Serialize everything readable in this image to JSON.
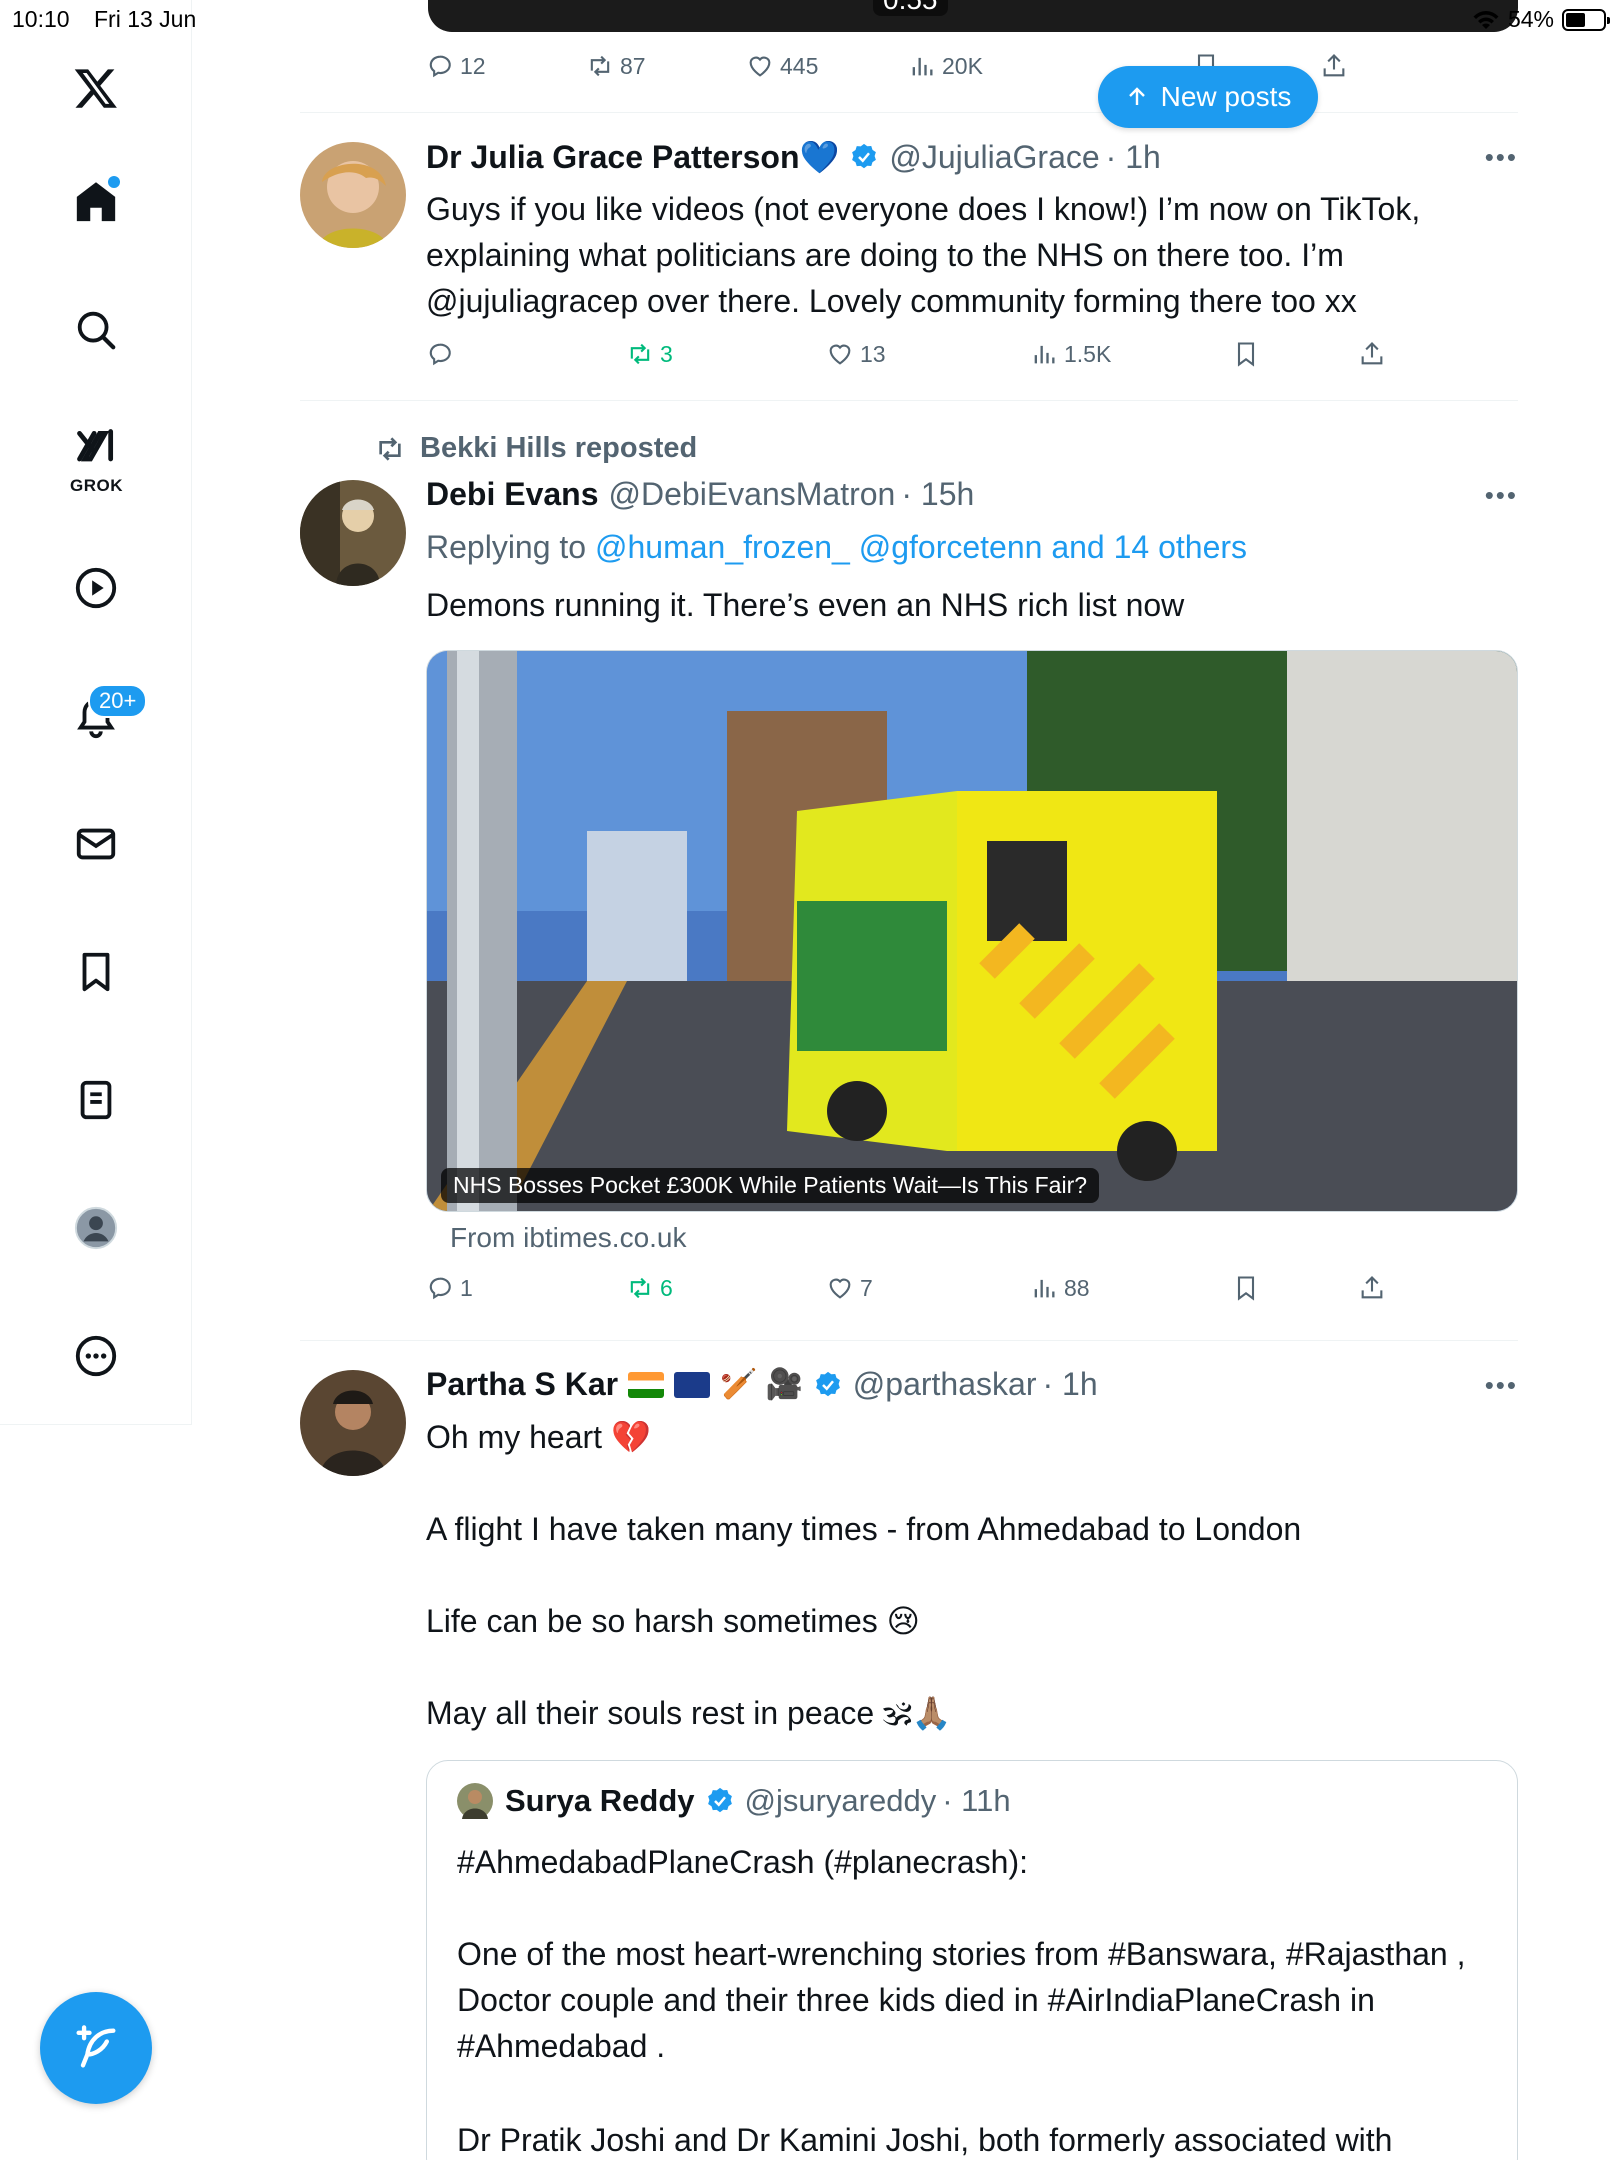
{
  "status_bar": {
    "time": "10:10",
    "date": "Fri 13 Jun",
    "battery": "54%",
    "battery_level": 0.54
  },
  "sidebar": {
    "grok_label": "GROK",
    "notifications_badge": "20+",
    "items": [
      "x-logo",
      "home",
      "search",
      "grok",
      "video",
      "notifications",
      "messages",
      "bookmarks",
      "lists",
      "profile",
      "more"
    ]
  },
  "new_posts_label": "New posts",
  "top_post": {
    "video_time": "0:55",
    "replies": "12",
    "reposts": "87",
    "likes": "445",
    "views": "20K"
  },
  "post1": {
    "name": "Dr Julia Grace Patterson💙",
    "handle": "@JujuliaGrace",
    "time": "· 1h",
    "text": "Guys if you like videos (not everyone does I know!) I’m now on TikTok, explaining what politicians are doing to the NHS on there too. I’m @jujuliagracep over there. Lovely community forming there too xx",
    "replies": "",
    "reposts": "3",
    "likes": "13",
    "views": "1.5K"
  },
  "post2": {
    "reposted_by": "Bekki Hills reposted",
    "name": "Debi Evans",
    "handle": "@DebiEvansMatron",
    "time": "· 15h",
    "replying_prefix": "Replying to ",
    "replying_targets": "@human_frozen_ @gforcetenn and 14 others",
    "text": "Demons running it. There’s even an NHS rich list now",
    "media_caption": "NHS Bosses Pocket £300K While Patients Wait—Is This Fair?",
    "source": "From ibtimes.co.uk",
    "replies": "1",
    "reposts": "6",
    "likes": "7",
    "views": "88"
  },
  "post3": {
    "name": "Partha S Kar",
    "handle": "@parthaskar",
    "time": "· 1h",
    "line1": "Oh my heart 💔",
    "line2": "A flight I have taken many times - from Ahmedabad to London",
    "line3": "Life can be so harsh sometimes 😢",
    "line4": "May all their souls rest in peace 🕉🙏🏽",
    "quote": {
      "name": "Surya Reddy",
      "handle": "@jsuryareddy",
      "time": "· 11h",
      "line1": "#AhmedabadPlaneCrash (#planecrash):",
      "line2": "One of the most heart-wrenching stories from #Banswara, #Rajasthan , Doctor couple and their three kids died in #AirIndiaPlaneCrash in #Ahmedabad .",
      "line3": "Dr Pratik Joshi and Dr Kamini Joshi, both formerly associated with"
    }
  },
  "colors": {
    "accent": "#1d9bf0",
    "repost_green": "#00ba7c",
    "muted": "#536471"
  }
}
